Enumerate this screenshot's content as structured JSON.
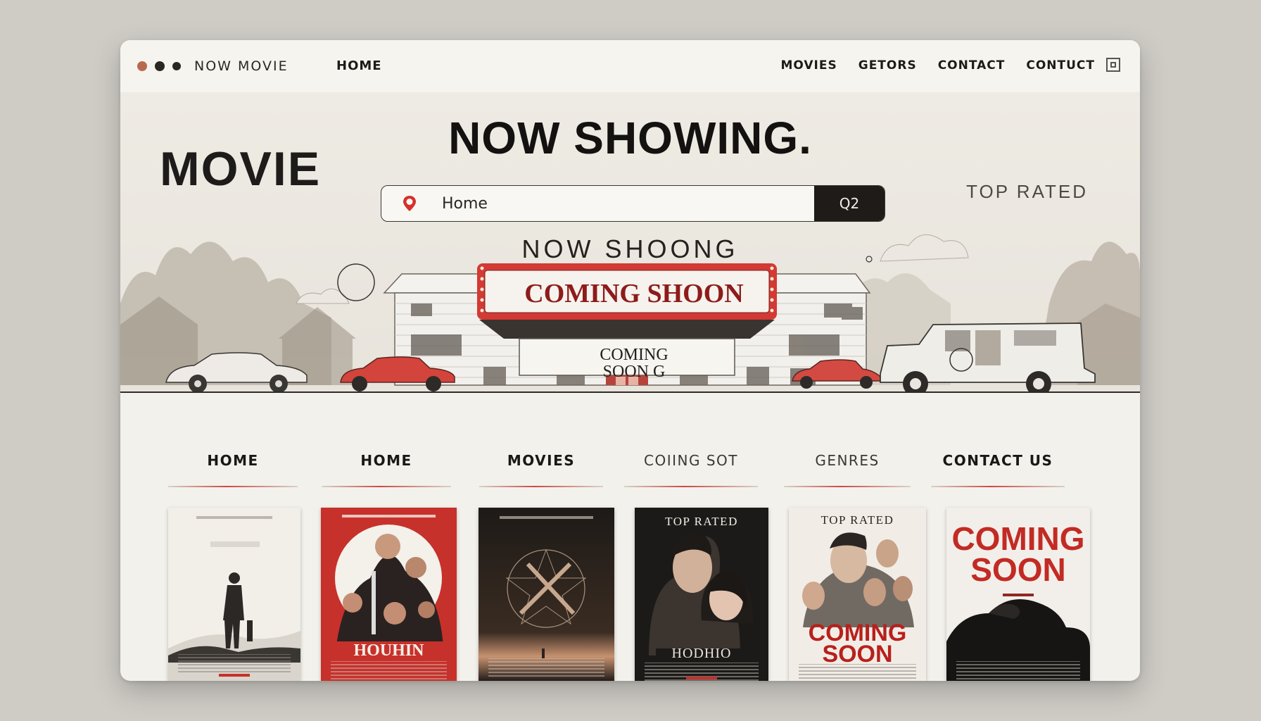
{
  "window": {
    "brand": "NOW MOVIE",
    "home_link": "HOME",
    "top_nav": [
      "MOVIES",
      "GETORS",
      "CONTACT",
      "CONTUCT"
    ]
  },
  "hero": {
    "logo": "MOVIE",
    "title": "NOW SHOWING.",
    "search": {
      "value": "Home",
      "button_label": "Q2"
    },
    "top_rated_link": "TOP RATED",
    "marquee_heading": "NOW SHOONG",
    "marquee_sign": "COMING SHOON",
    "board_line_1": "COMING",
    "board_line_2": "SOON G"
  },
  "tabs": [
    "HOME",
    "HOME",
    "MOVIES",
    "COIING SOT",
    "GENRES",
    "CONTACT US"
  ],
  "posters": [
    {
      "label": ""
    },
    {
      "label": "HOUHIN"
    },
    {
      "label": ""
    },
    {
      "top_label": "TOP RATED",
      "label": "HODHIO"
    },
    {
      "top_label": "TOP RATED",
      "label_1": "COMING",
      "label_2": "SOON"
    },
    {
      "label_1": "COMING",
      "label_2": "SOON"
    }
  ],
  "colors": {
    "accent_red": "#c8302a",
    "dark": "#1e1b19",
    "panel": "#f3f1ec"
  }
}
